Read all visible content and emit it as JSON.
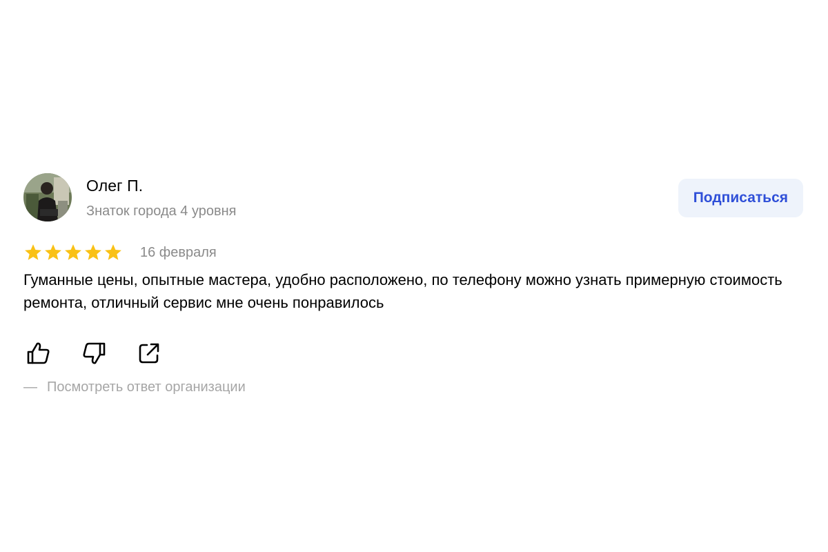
{
  "review": {
    "author": {
      "name": "Олег П.",
      "level": "Знаток города 4 уровня",
      "avatar_icon": "user-avatar-photo"
    },
    "subscribe_label": "Подписаться",
    "rating": {
      "value": 5,
      "max": 5,
      "color": "#f9c116"
    },
    "date": "16 февраля",
    "text": "Гуманные цены, опытные мастера, удобно расположено, по телефону можно узнать примерную стоимость ремонта, отличный сервис мне очень понравилось",
    "actions": [
      {
        "icon": "thumbs-up-icon"
      },
      {
        "icon": "thumbs-down-icon"
      },
      {
        "icon": "share-icon"
      }
    ],
    "org_reply": {
      "dash": "—",
      "label": "Посмотреть ответ организации"
    }
  },
  "colors": {
    "accent": "#2f4fd8",
    "button_bg": "#eef3fb",
    "secondary_text": "#8a8a8a",
    "star": "#f9c116"
  }
}
